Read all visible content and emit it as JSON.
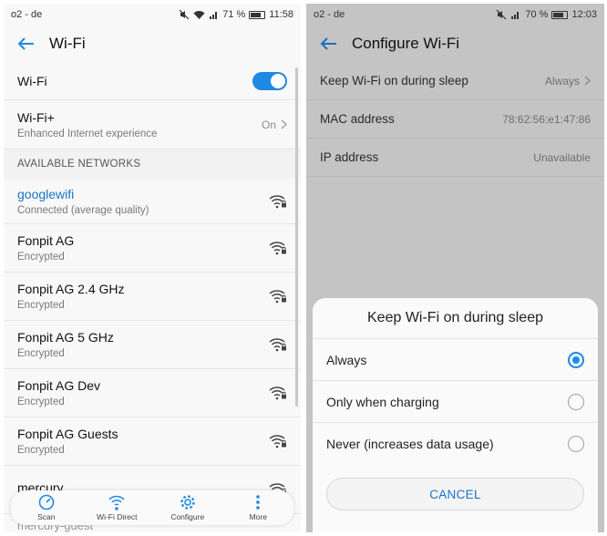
{
  "left": {
    "status": {
      "carrier": "o2 - de",
      "battery": "71 %",
      "time": "11:58"
    },
    "appbar": {
      "title": "Wi-Fi"
    },
    "wifi_row": {
      "label": "Wi-Fi",
      "enabled": true
    },
    "wifiplus": {
      "label": "Wi-Fi+",
      "sub": "Enhanced Internet experience",
      "value": "On"
    },
    "section": "AVAILABLE NETWORKS",
    "networks": [
      {
        "name": "googlewifi",
        "status": "Connected (average quality)"
      },
      {
        "name": "Fonpit AG",
        "status": "Encrypted"
      },
      {
        "name": "Fonpit AG 2.4 GHz",
        "status": "Encrypted"
      },
      {
        "name": "Fonpit AG 5 GHz",
        "status": "Encrypted"
      },
      {
        "name": "Fonpit AG Dev",
        "status": "Encrypted"
      },
      {
        "name": "Fonpit AG Guests",
        "status": "Encrypted"
      },
      {
        "name": "mercury",
        "status": ""
      }
    ],
    "overlap_text": "mercury-guest",
    "bottomnav": {
      "scan": "Scan",
      "direct": "Wi-Fi Direct",
      "configure": "Configure",
      "more": "More"
    }
  },
  "right": {
    "status": {
      "carrier": "o2 - de",
      "battery": "70 %",
      "time": "12:03"
    },
    "appbar": {
      "title": "Configure Wi-Fi"
    },
    "rows": [
      {
        "label": "Keep Wi-Fi on during sleep",
        "value": "Always"
      },
      {
        "label": "MAC address",
        "value": "78:62:56:e1:47:86"
      },
      {
        "label": "IP address",
        "value": "Unavailable"
      }
    ],
    "dialog": {
      "title": "Keep Wi-Fi on during sleep",
      "options": [
        "Always",
        "Only when charging",
        "Never (increases data usage)"
      ],
      "selected": "Always",
      "cancel": "CANCEL"
    }
  },
  "colors": {
    "accent": "#1e88e5",
    "link": "#1a73c8"
  }
}
